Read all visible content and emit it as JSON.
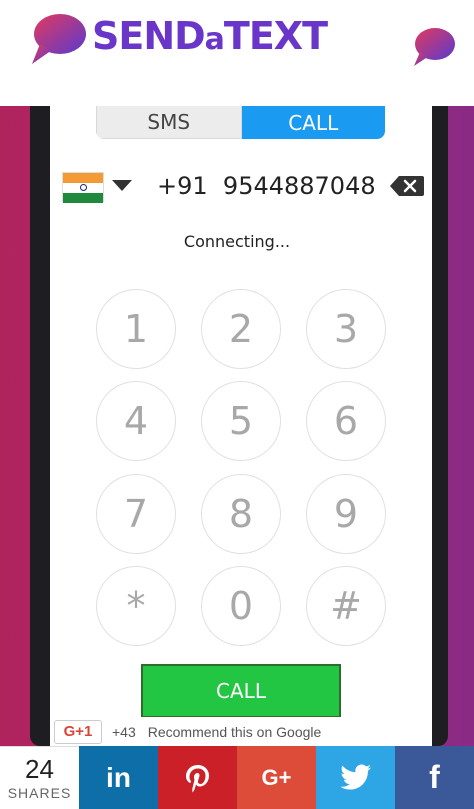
{
  "header": {
    "logo": {
      "prefix": "SEND",
      "middle": "a",
      "suffix": "TEXT"
    },
    "brand_colors": {
      "logo_text": "#6a35c9",
      "bubble_start": "#e23a5c",
      "bubble_end": "#5a3ad0"
    },
    "menu_icon": "chat-bubble-icon"
  },
  "tabs": [
    {
      "label": "SMS",
      "active": false
    },
    {
      "label": "CALL",
      "active": true
    }
  ],
  "dialer": {
    "country_flag": "india-flag-icon",
    "country_code": "+91",
    "number": "9544887048",
    "status": "Connecting..."
  },
  "keypad": [
    "1",
    "2",
    "3",
    "4",
    "5",
    "6",
    "7",
    "8",
    "9",
    "*",
    "0",
    "#"
  ],
  "call_button": {
    "label": "CALL",
    "color": "#23c643"
  },
  "google_plus": {
    "button_label": "G+1",
    "count": "+43",
    "text": "Recommend this on Google"
  },
  "share": {
    "count": "24",
    "label": "SHARES",
    "buttons": [
      {
        "network": "LinkedIn",
        "icon": "linkedin-icon",
        "glyph": "in",
        "color": "#0e6fa8"
      },
      {
        "network": "Pinterest",
        "icon": "pinterest-icon",
        "color": "#cb2027"
      },
      {
        "network": "Google+",
        "icon": "google-plus-icon",
        "glyph": "G+",
        "color": "#dd4b39"
      },
      {
        "network": "Twitter",
        "icon": "twitter-icon",
        "color": "#2ea6e6"
      },
      {
        "network": "Facebook",
        "icon": "facebook-icon",
        "glyph": "f",
        "color": "#3b5998"
      }
    ]
  }
}
